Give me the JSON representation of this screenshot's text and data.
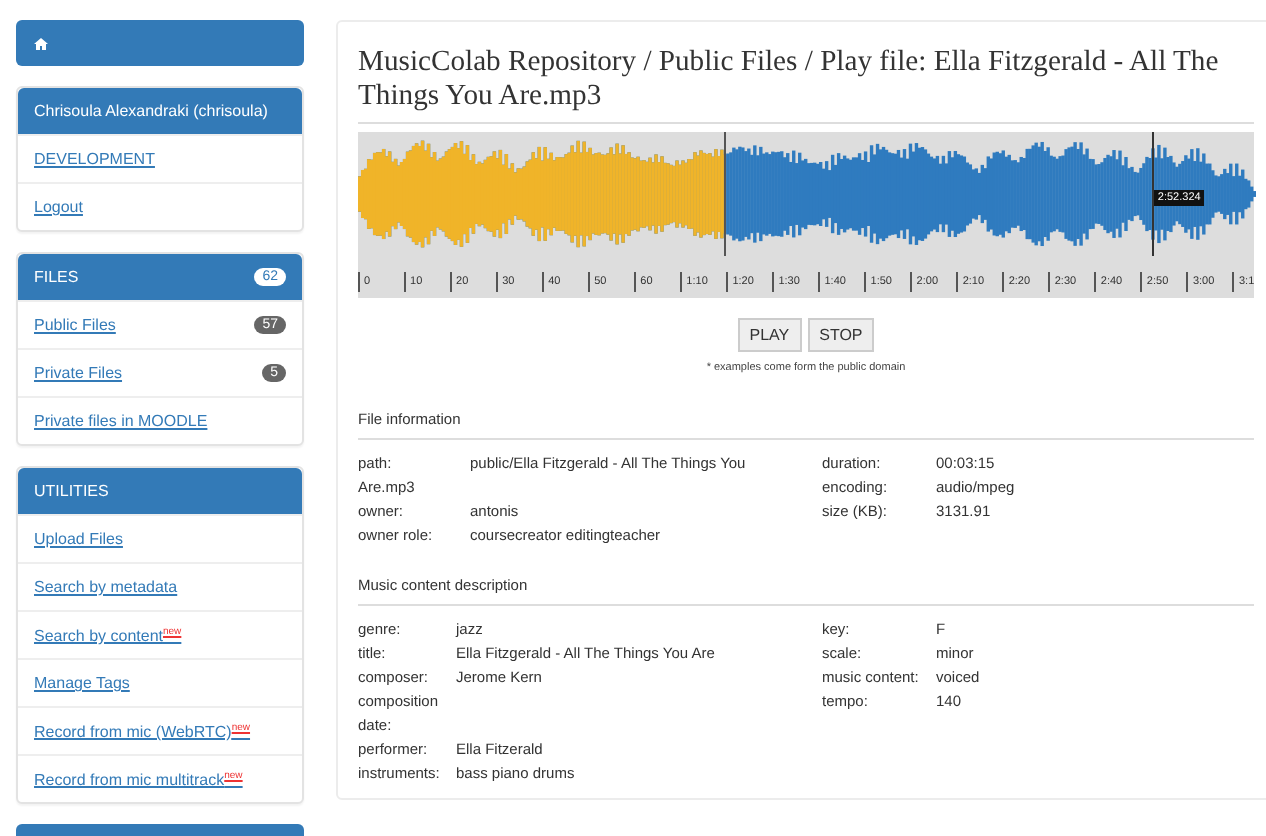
{
  "sidebar": {
    "panels": [
      {
        "title": "Chrisoula Alexandraki (chrisoula)",
        "items": [
          {
            "label": "DEVELOPMENT"
          },
          {
            "label": "Logout"
          }
        ]
      },
      {
        "title": "FILES",
        "badge": "62",
        "items": [
          {
            "label": "Public Files",
            "badge": "57"
          },
          {
            "label": "Private Files",
            "badge": "5"
          },
          {
            "label": "Private files in MOODLE"
          }
        ]
      },
      {
        "title": "UTILITIES",
        "items": [
          {
            "label": "Upload Files"
          },
          {
            "label": "Search by metadata"
          },
          {
            "label": "Search by content",
            "tag": "new"
          },
          {
            "label": "Manage Tags"
          },
          {
            "label": "Record from mic (WebRTC)",
            "tag": "new"
          },
          {
            "label": "Record from mic multitrack",
            "tag": "new"
          }
        ]
      }
    ]
  },
  "page_title": "MusicColab Repository / Public Files / Play file: Ella Fitzgerald - All The Things You Are.mp3",
  "player": {
    "level": 0.41,
    "hover_time": "2:52.324",
    "ticks": [
      "0",
      "10",
      "20",
      "30",
      "40",
      "50",
      "60",
      "1:10",
      "1:20",
      "1:30",
      "1:40",
      "1:50",
      "2:00",
      "2:10",
      "2:20",
      "2:30",
      "2:40",
      "2:50",
      "3:00",
      "3:1"
    ],
    "buttons": [
      "PLAY",
      "STOP"
    ],
    "note": "* examples come form the public domain"
  },
  "sections": [
    {
      "title": "File information",
      "columns": [
        [
          {
            "label": "path:",
            "value": "public/Ella Fitzgerald - All The Things You Are.mp3",
            "kind": "flow"
          },
          {
            "label": "owner:",
            "value": "antonis",
            "kind": "flow"
          },
          {
            "label": "owner role:",
            "value": "coursecreator editingteacher",
            "kind": "flow"
          }
        ],
        [
          {
            "label": "duration:",
            "value": "00:03:15"
          },
          {
            "label": "encoding:",
            "value": "audio/mpeg"
          },
          {
            "label": "size (KB):",
            "value": "3131.91"
          }
        ]
      ]
    },
    {
      "title": "Music content description",
      "columns": [
        [
          {
            "label": "genre:",
            "value": "jazz"
          },
          {
            "label": "title:",
            "value": "Ella Fitzgerald - All The Things You Are"
          },
          {
            "label": "composer:",
            "value": "Jerome Kern"
          },
          {
            "label": "composition date:"
          },
          {
            "label": "performer:",
            "value": "Ella Fitzerald"
          },
          {
            "label": "instruments:",
            "value": "bass piano drums"
          }
        ],
        [
          {
            "label": "key:",
            "value": "F"
          },
          {
            "label": "scale:",
            "value": "minor"
          },
          {
            "label": "music content:",
            "value": "voiced"
          },
          {
            "label": "tempo:",
            "value": "140"
          }
        ]
      ]
    }
  ]
}
